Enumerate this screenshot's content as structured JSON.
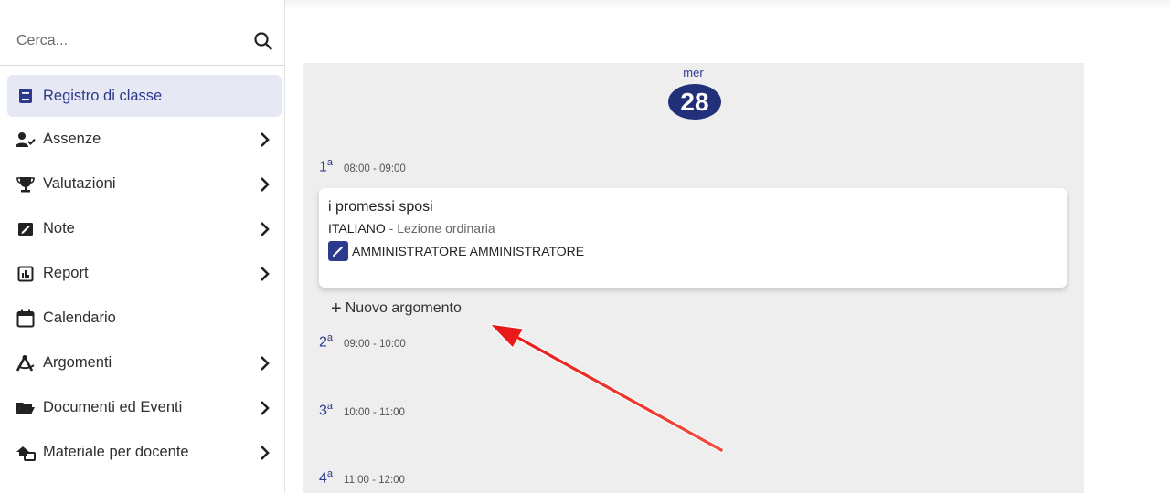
{
  "search": {
    "placeholder": "Cerca..."
  },
  "sidebar": {
    "items": [
      {
        "label": "Registro di classe",
        "icon": "book-icon",
        "active": true,
        "has_chevron": false
      },
      {
        "label": "Assenze",
        "icon": "user-check-icon",
        "active": false,
        "has_chevron": true
      },
      {
        "label": "Valutazioni",
        "icon": "trophy-icon",
        "active": false,
        "has_chevron": true
      },
      {
        "label": "Note",
        "icon": "note-icon",
        "active": false,
        "has_chevron": true
      },
      {
        "label": "Report",
        "icon": "chart-icon",
        "active": false,
        "has_chevron": true
      },
      {
        "label": "Calendario",
        "icon": "calendar-icon",
        "active": false,
        "has_chevron": false
      },
      {
        "label": "Argomenti",
        "icon": "compass-icon",
        "active": false,
        "has_chevron": true
      },
      {
        "label": "Documenti ed Eventi",
        "icon": "folder-icon",
        "active": false,
        "has_chevron": true
      },
      {
        "label": "Materiale per docente",
        "icon": "share-icon",
        "active": false,
        "has_chevron": true
      }
    ]
  },
  "day": {
    "name": "mer",
    "number": "28"
  },
  "slots": [
    {
      "ordinal": "1",
      "suffix": "a",
      "time": "08:00 - 09:00"
    },
    {
      "ordinal": "2",
      "suffix": "a",
      "time": "09:00 - 10:00"
    },
    {
      "ordinal": "3",
      "suffix": "a",
      "time": "10:00 - 11:00"
    },
    {
      "ordinal": "4",
      "suffix": "a",
      "time": "11:00 - 12:00"
    }
  ],
  "lesson": {
    "title": "i promessi sposi",
    "subject": "ITALIANO",
    "separator": " - ",
    "type": "Lezione ordinaria",
    "teacher": "AMMINISTRATORE AMMINISTRATORE"
  },
  "add_topic": {
    "label": "Nuovo argomento"
  },
  "colors": {
    "accent": "#2c3a8c",
    "panel": "#eeeeee",
    "annotation_arrow": "#e81010"
  }
}
